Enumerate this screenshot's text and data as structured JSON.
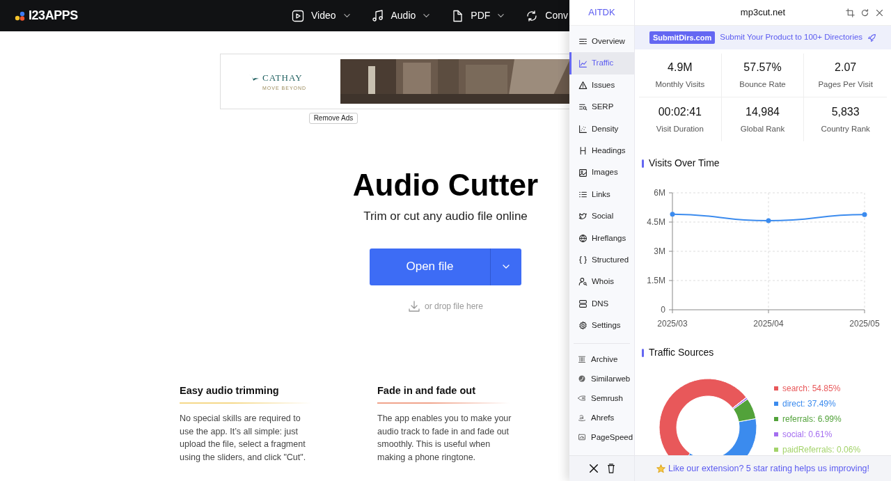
{
  "site": {
    "logo": "I23APPS",
    "nav": [
      {
        "label": "Video"
      },
      {
        "label": "Audio"
      },
      {
        "label": "PDF"
      },
      {
        "label": "Conv"
      }
    ]
  },
  "ad": {
    "brand": "CATHAY",
    "tagline": "MOVE BEYOND",
    "remove": "Remove Ads"
  },
  "hero": {
    "title": "Audio Cutter",
    "subtitle": "Trim or cut any audio file online",
    "button": "Open file",
    "drop": "or drop file here"
  },
  "features": [
    {
      "title": "Easy audio trimming",
      "text": "No special skills are required to use the app. It’s all simple: just upload the file, select a fragment using the sliders, and click \"Cut\".",
      "color": "#f5d98a"
    },
    {
      "title": "Fade in and fade out",
      "text": "The app enables you to make your audio track to fade in and fade out smoothly. This is useful when making a phone ringtone.",
      "color": "#f0a48c"
    }
  ],
  "panel": {
    "brand": "AITDK",
    "domain": "mp3cut.net",
    "sidebar": [
      {
        "label": "Overview",
        "selected": false
      },
      {
        "label": "Traffic",
        "selected": true
      },
      {
        "label": "Issues",
        "selected": false
      },
      {
        "label": "SERP",
        "selected": false
      },
      {
        "label": "Density",
        "selected": false
      },
      {
        "label": "Headings",
        "selected": false
      },
      {
        "label": "Images",
        "selected": false
      },
      {
        "label": "Links",
        "selected": false
      },
      {
        "label": "Social",
        "selected": false
      },
      {
        "label": "Hreflangs",
        "selected": false
      },
      {
        "label": "Structured",
        "selected": false
      },
      {
        "label": "Whois",
        "selected": false
      },
      {
        "label": "DNS",
        "selected": false
      },
      {
        "label": "Settings",
        "selected": false
      }
    ],
    "tools": [
      {
        "label": "Archive"
      },
      {
        "label": "Similarweb"
      },
      {
        "label": "Semrush"
      },
      {
        "label": "Ahrefs"
      },
      {
        "label": "PageSpeed"
      }
    ],
    "banner": {
      "badge": "SubmitDirs.com",
      "text": "Submit Your Product to 100+ Directories"
    },
    "stats": [
      {
        "value": "4.9M",
        "label": "Monthly Visits"
      },
      {
        "value": "57.57%",
        "label": "Bounce Rate"
      },
      {
        "value": "2.07",
        "label": "Pages Per Visit"
      },
      {
        "value": "00:02:41",
        "label": "Visit Duration"
      },
      {
        "value": "14,984",
        "label": "Global Rank"
      },
      {
        "value": "5,833",
        "label": "Country Rank"
      }
    ],
    "visits": {
      "chart_data": {
        "type": "line",
        "title": "Visits Over Time",
        "grid": true,
        "categories": [
          "2025/03",
          "2025/04",
          "2025/05"
        ],
        "series": [
          {
            "color": "#3b8bee",
            "marker": true,
            "values": [
              4.9,
              4.57,
              4.88
            ]
          }
        ],
        "ylim": [
          0,
          6
        ],
        "yticks": [
          {
            "value": 0,
            "label": "0"
          },
          {
            "value": 1.5,
            "label": "1.5M"
          },
          {
            "value": 3,
            "label": "3M"
          },
          {
            "value": 4.5,
            "label": "4.5M"
          },
          {
            "value": 6,
            "label": "6M"
          }
        ]
      }
    },
    "sources": {
      "chart_data": {
        "type": "donut",
        "title": "Traffic Sources",
        "categories": [
          "search: 54.85%",
          "direct: 37.49%",
          "referrals: 6.99%",
          "social: 0.61%",
          "paidReferrals: 0.06%"
        ],
        "values": [
          54.85,
          37.49,
          6.99,
          0.61,
          0.06
        ],
        "colors": [
          "#e8585a",
          "#3b8bee",
          "#52a23a",
          "#a46ef0",
          "#a3d36a"
        ]
      }
    },
    "footer": "Like our extension? 5 star rating helps us improving!"
  }
}
